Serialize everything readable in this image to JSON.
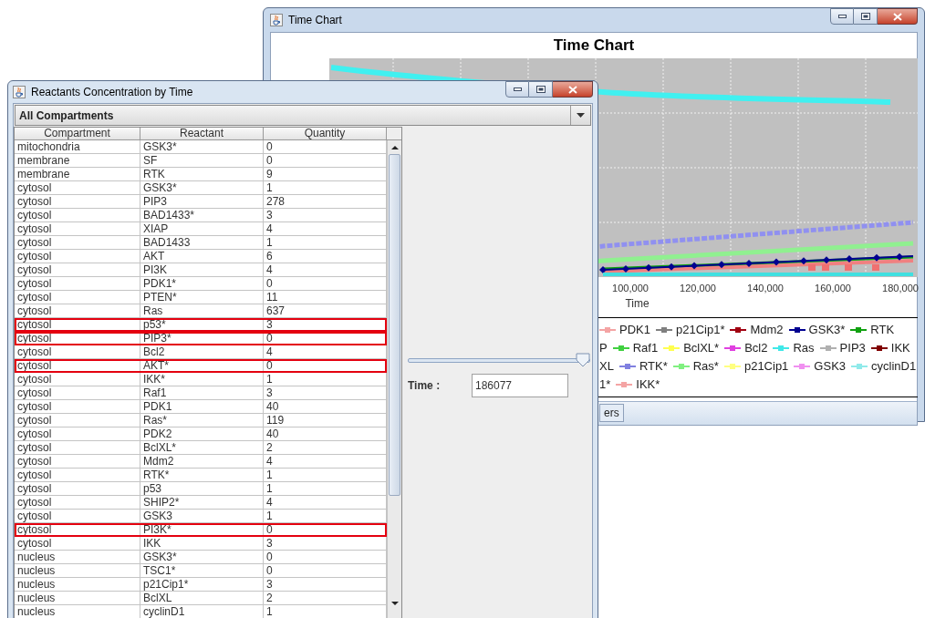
{
  "chart_window": {
    "title": "Time Chart",
    "chart_title": "Time Chart",
    "x_ticks": [
      "100,000",
      "120,000",
      "140,000",
      "160,000",
      "180,000"
    ],
    "x_label": "Time",
    "legend": [
      {
        "items": [
          {
            "label": "PDK1",
            "color": "#f4a4a4"
          },
          {
            "label": "p21Cip1*",
            "color": "#808080"
          },
          {
            "label": "Mdm2",
            "color": "#a00010"
          },
          {
            "label": "GSK3*",
            "color": "#000090"
          },
          {
            "label": "RTK",
            "color": "#10a010"
          }
        ]
      },
      {
        "items": [
          {
            "label": "P"
          },
          {
            "label": "Raf1",
            "color": "#40d040"
          },
          {
            "label": "BclXL*",
            "color": "#ffff50"
          },
          {
            "label": "Bcl2",
            "color": "#e040e0"
          },
          {
            "label": "Ras",
            "color": "#40e8e8"
          },
          {
            "label": "PIP3",
            "color": "#b0b0b0"
          },
          {
            "label": "IKK",
            "color": "#800000"
          }
        ]
      },
      {
        "items": [
          {
            "label": "XL"
          },
          {
            "label": "RTK*",
            "color": "#8080e0"
          },
          {
            "label": "Ras*",
            "color": "#80f080"
          },
          {
            "label": "p21Cip1",
            "color": "#ffff80"
          },
          {
            "label": "GSK3",
            "color": "#f090f0"
          },
          {
            "label": "cyclinD1",
            "color": "#90eaea"
          }
        ]
      },
      {
        "items": [
          {
            "label": "1*"
          },
          {
            "label": "IKK*",
            "color": "#f4a4a4"
          }
        ]
      }
    ],
    "tabs": [
      {
        "label": "ers"
      }
    ]
  },
  "reactants_window": {
    "title": "Reactants Concentration by Time",
    "compartment_dropdown": {
      "value": "All Compartments"
    },
    "table": {
      "columns": [
        "Compartment",
        "Reactant",
        "Quantity"
      ],
      "rows": [
        {
          "compartment": "mitochondria",
          "reactant": "GSK3*",
          "quantity": "0",
          "highlighted": false
        },
        {
          "compartment": "membrane",
          "reactant": "SF",
          "quantity": "0",
          "highlighted": false
        },
        {
          "compartment": "membrane",
          "reactant": "RTK",
          "quantity": "9",
          "highlighted": false
        },
        {
          "compartment": "cytosol",
          "reactant": "GSK3*",
          "quantity": "1",
          "highlighted": false
        },
        {
          "compartment": "cytosol",
          "reactant": "PIP3",
          "quantity": "278",
          "highlighted": false
        },
        {
          "compartment": "cytosol",
          "reactant": "BAD1433*",
          "quantity": "3",
          "highlighted": false
        },
        {
          "compartment": "cytosol",
          "reactant": "XIAP",
          "quantity": "4",
          "highlighted": false
        },
        {
          "compartment": "cytosol",
          "reactant": "BAD1433",
          "quantity": "1",
          "highlighted": false
        },
        {
          "compartment": "cytosol",
          "reactant": "AKT",
          "quantity": "6",
          "highlighted": false
        },
        {
          "compartment": "cytosol",
          "reactant": "PI3K",
          "quantity": "4",
          "highlighted": false
        },
        {
          "compartment": "cytosol",
          "reactant": "PDK1*",
          "quantity": "0",
          "highlighted": false
        },
        {
          "compartment": "cytosol",
          "reactant": "PTEN*",
          "quantity": "11",
          "highlighted": false
        },
        {
          "compartment": "cytosol",
          "reactant": "Ras",
          "quantity": "637",
          "highlighted": false
        },
        {
          "compartment": "cytosol",
          "reactant": "p53*",
          "quantity": "3",
          "highlighted": true
        },
        {
          "compartment": "cytosol",
          "reactant": "PIP3*",
          "quantity": "0",
          "highlighted": true
        },
        {
          "compartment": "cytosol",
          "reactant": "Bcl2",
          "quantity": "4",
          "highlighted": false
        },
        {
          "compartment": "cytosol",
          "reactant": "AKT*",
          "quantity": "0",
          "highlighted": true
        },
        {
          "compartment": "cytosol",
          "reactant": "IKK*",
          "quantity": "1",
          "highlighted": false
        },
        {
          "compartment": "cytosol",
          "reactant": "Raf1",
          "quantity": "3",
          "highlighted": false
        },
        {
          "compartment": "cytosol",
          "reactant": "PDK1",
          "quantity": "40",
          "highlighted": false
        },
        {
          "compartment": "cytosol",
          "reactant": "Ras*",
          "quantity": "119",
          "highlighted": false
        },
        {
          "compartment": "cytosol",
          "reactant": "PDK2",
          "quantity": "40",
          "highlighted": false
        },
        {
          "compartment": "cytosol",
          "reactant": "BclXL*",
          "quantity": "2",
          "highlighted": false
        },
        {
          "compartment": "cytosol",
          "reactant": "Mdm2",
          "quantity": "4",
          "highlighted": false
        },
        {
          "compartment": "cytosol",
          "reactant": "RTK*",
          "quantity": "1",
          "highlighted": false
        },
        {
          "compartment": "cytosol",
          "reactant": "p53",
          "quantity": "1",
          "highlighted": false
        },
        {
          "compartment": "cytosol",
          "reactant": "SHIP2*",
          "quantity": "4",
          "highlighted": false
        },
        {
          "compartment": "cytosol",
          "reactant": "GSK3",
          "quantity": "1",
          "highlighted": false
        },
        {
          "compartment": "cytosol",
          "reactant": "PI3K*",
          "quantity": "0",
          "highlighted": true
        },
        {
          "compartment": "cytosol",
          "reactant": "IKK",
          "quantity": "3",
          "highlighted": false
        },
        {
          "compartment": "nucleus",
          "reactant": "GSK3*",
          "quantity": "0",
          "highlighted": false
        },
        {
          "compartment": "nucleus",
          "reactant": "TSC1*",
          "quantity": "0",
          "highlighted": false
        },
        {
          "compartment": "nucleus",
          "reactant": "p21Cip1*",
          "quantity": "3",
          "highlighted": false
        },
        {
          "compartment": "nucleus",
          "reactant": "BclXL",
          "quantity": "2",
          "highlighted": false
        },
        {
          "compartment": "nucleus",
          "reactant": "cyclinD1",
          "quantity": "1",
          "highlighted": false
        }
      ]
    },
    "time_slider": {
      "level": 1
    },
    "time_field": {
      "label": "Time :",
      "value": "186077"
    }
  }
}
